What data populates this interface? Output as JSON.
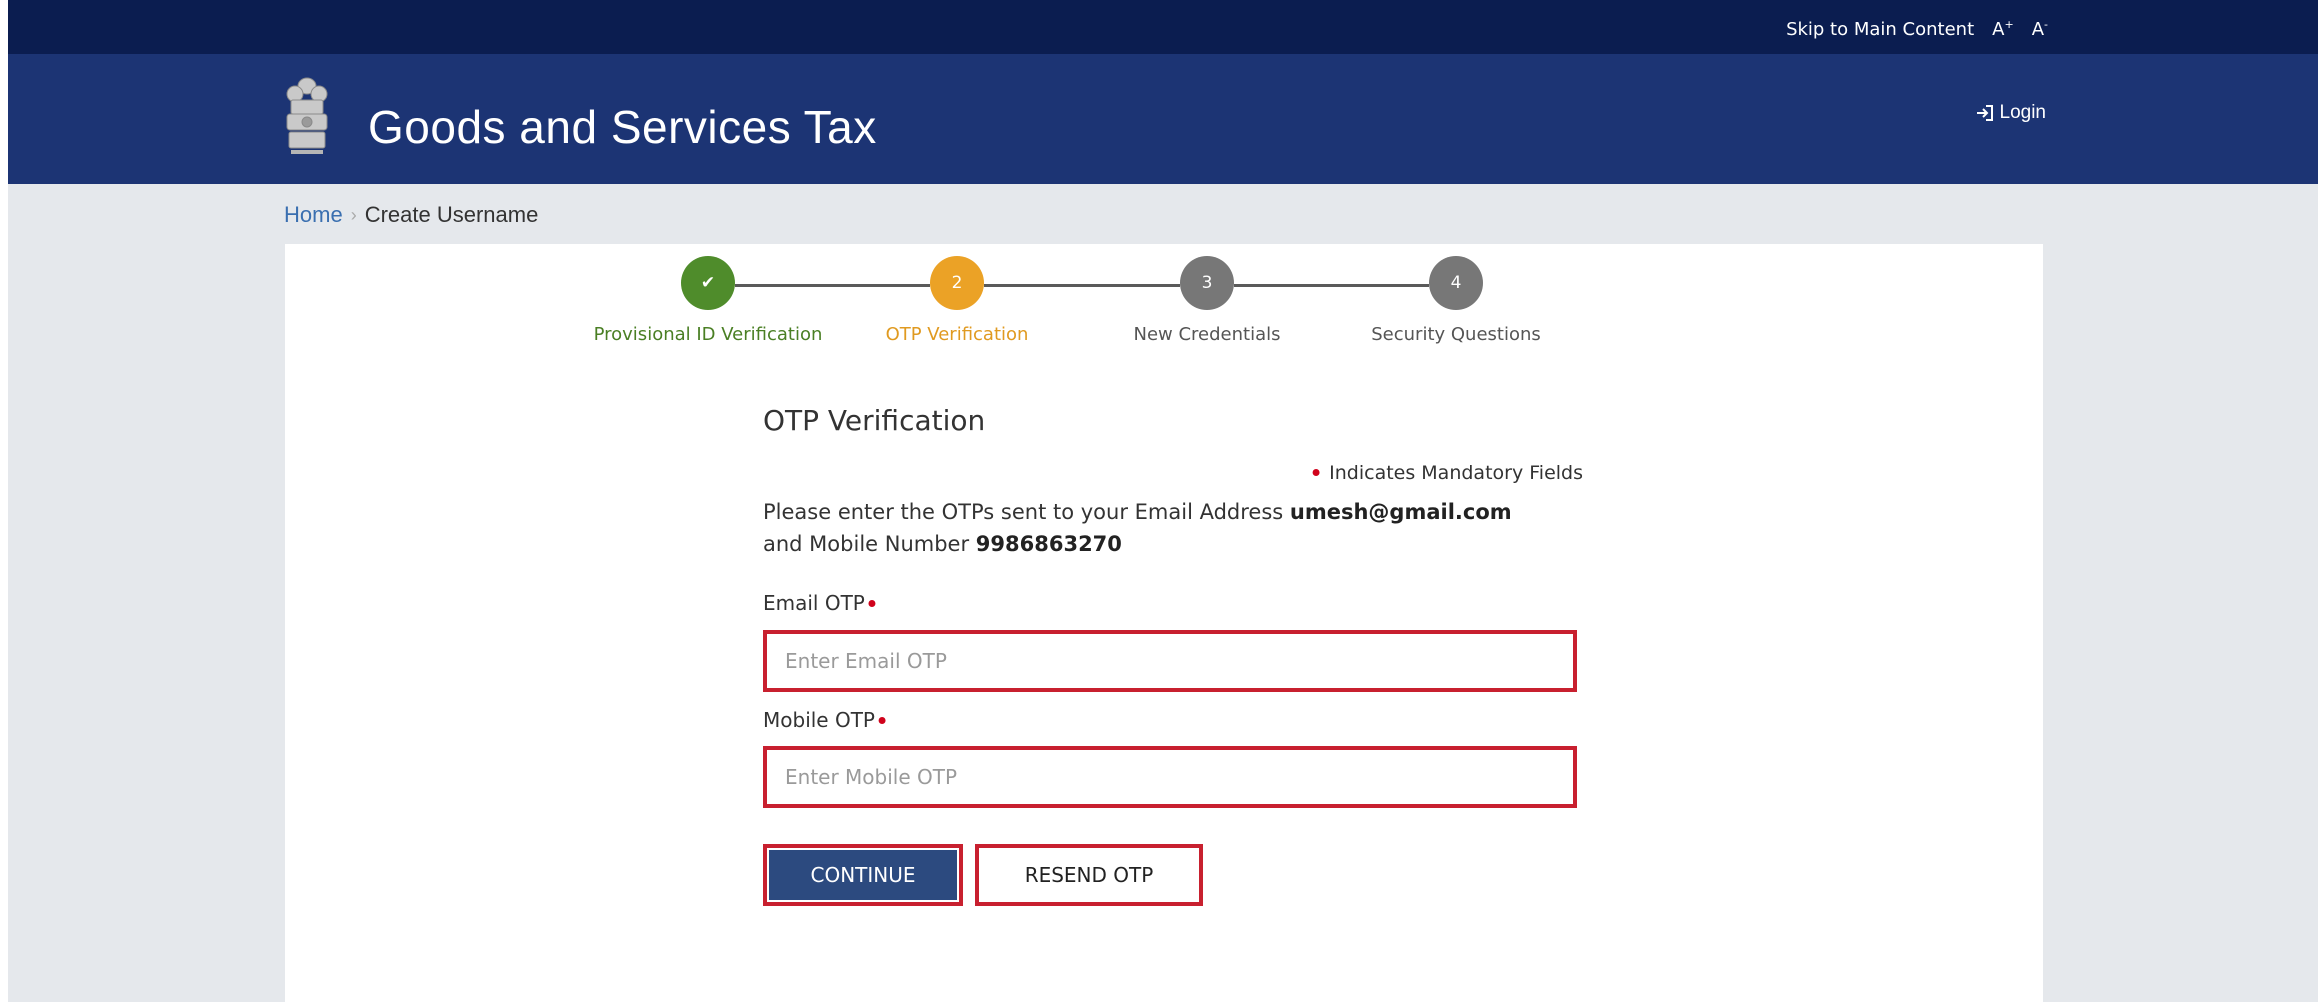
{
  "topbar": {
    "skip_label": "Skip to Main Content",
    "font_increase_label": "A",
    "font_increase_sup": "+",
    "font_decrease_label": "A",
    "font_decrease_sup": "-"
  },
  "header": {
    "title": "Goods and Services Tax",
    "login_label": "Login"
  },
  "breadcrumb": {
    "home": "Home",
    "current": "Create Username"
  },
  "stepper": {
    "steps": [
      {
        "number": "✔",
        "label": "Provisional ID Verification",
        "state": "done"
      },
      {
        "number": "2",
        "label": "OTP Verification",
        "state": "active"
      },
      {
        "number": "3",
        "label": "New Credentials",
        "state": "pending"
      },
      {
        "number": "4",
        "label": "Security Questions",
        "state": "pending"
      }
    ]
  },
  "form": {
    "title": "OTP Verification",
    "mandatory_note": "Indicates Mandatory Fields",
    "instruction_prefix": "Please enter the OTPs sent to your Email Address ",
    "email": "umesh@gmail.com",
    "instruction_middle": "and Mobile Number ",
    "mobile": "9986863270",
    "email_otp_label": "Email OTP",
    "email_otp_placeholder": "Enter Email OTP",
    "email_otp_value": "",
    "mobile_otp_label": "Mobile OTP",
    "mobile_otp_placeholder": "Enter Mobile OTP",
    "mobile_otp_value": "",
    "continue_label": "CONTINUE",
    "resend_label": "RESEND OTP"
  },
  "colors": {
    "topbar_bg": "#0b1d50",
    "header_bg": "#1c3474",
    "step_done": "#4f8c2b",
    "step_active": "#eba226",
    "step_pending": "#777777",
    "highlight_border": "#c8202f",
    "primary_button": "#2c4a7f"
  }
}
